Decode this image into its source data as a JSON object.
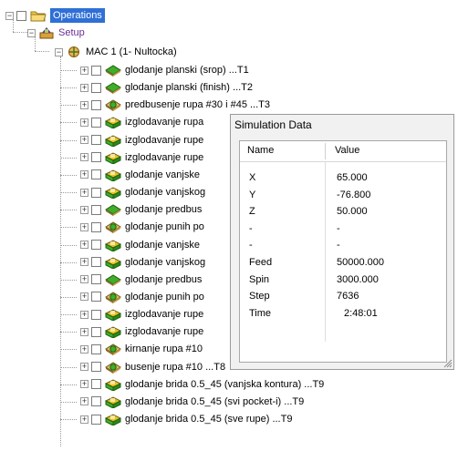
{
  "tree": {
    "root_label": "Operations",
    "setup_label": "Setup",
    "machine_label": "MAC 1 (1- Nultocka)",
    "operations": [
      {
        "label": "glodanje planski (srop) ...T1",
        "icon": "face-mill-icon"
      },
      {
        "label": "glodanje planski (finish) ...T2",
        "icon": "face-mill-icon"
      },
      {
        "label": "predbusenje rupa #30 i #45 ...T3",
        "icon": "drill-icon"
      },
      {
        "label": "izglodavanje rupa",
        "icon": "contour-mill-icon"
      },
      {
        "label": "izglodavanje rupe",
        "icon": "contour-mill-icon"
      },
      {
        "label": "izglodavanje rupe",
        "icon": "contour-mill-icon"
      },
      {
        "label": "glodanje vanjske",
        "icon": "contour-mill-icon"
      },
      {
        "label": "glodanje vanjskog",
        "icon": "contour-mill-icon"
      },
      {
        "label": "glodanje predbus",
        "icon": "face-mill-icon"
      },
      {
        "label": "glodanje punih po",
        "icon": "drill-icon"
      },
      {
        "label": "glodanje vanjske",
        "icon": "contour-mill-icon"
      },
      {
        "label": "glodanje vanjskog",
        "icon": "contour-mill-icon"
      },
      {
        "label": "glodanje predbus",
        "icon": "face-mill-icon"
      },
      {
        "label": "glodanje punih po",
        "icon": "drill-icon"
      },
      {
        "label": "izglodavanje rupe",
        "icon": "contour-mill-icon"
      },
      {
        "label": "izglodavanje rupe",
        "icon": "contour-mill-icon"
      },
      {
        "label": "kirnanje rupa #10",
        "icon": "drill-icon"
      },
      {
        "label": "busenje rupa #10 ...T8",
        "icon": "drill-icon"
      },
      {
        "label": "glodanje brida 0.5_45 (vanjska kontura) ...T9",
        "icon": "contour-mill-icon"
      },
      {
        "label": "glodanje brida 0.5_45 (svi pocket-i) ...T9",
        "icon": "contour-mill-icon"
      },
      {
        "label": "glodanje brida 0.5_45 (sve rupe) ...T9",
        "icon": "contour-mill-icon"
      }
    ]
  },
  "simulation_panel": {
    "title": "Simulation Data",
    "col_name": "Name",
    "col_value": "Value",
    "rows": [
      {
        "name": "X",
        "value": "65.000"
      },
      {
        "name": "Y",
        "value": "-76.800"
      },
      {
        "name": "Z",
        "value": "50.000"
      },
      {
        "name": "-",
        "value": "-"
      },
      {
        "name": "-",
        "value": "-"
      },
      {
        "name": "Feed",
        "value": "50000.000"
      },
      {
        "name": "Spin",
        "value": "3000.000"
      },
      {
        "name": "Step",
        "value": "7636"
      },
      {
        "name": "Time",
        "value": "2:48:01"
      }
    ]
  },
  "colors": {
    "selection": "#2f6fd6",
    "face_mill_green": "#3fae2a",
    "contour_mill_yellow": "#e8c21b",
    "setup_purple": "#6b2d8f"
  }
}
